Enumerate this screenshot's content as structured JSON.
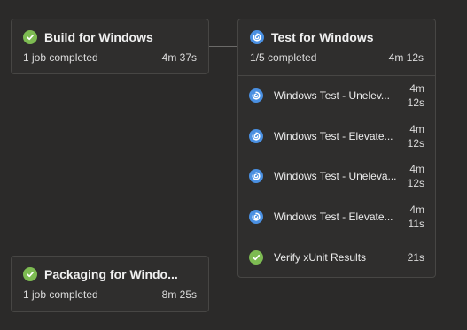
{
  "stages": {
    "build": {
      "title": "Build for Windows",
      "status": "success",
      "summary": "1 job completed",
      "duration": "4m 37s"
    },
    "test": {
      "title": "Test for Windows",
      "status": "running",
      "summary": "1/5 completed",
      "duration": "4m 12s",
      "jobs": [
        {
          "name": "Windows Test - Unelev...",
          "duration": "4m 12s",
          "status": "running"
        },
        {
          "name": "Windows Test - Elevate...",
          "duration": "4m 12s",
          "status": "running"
        },
        {
          "name": "Windows Test - Uneleva...",
          "duration": "4m 12s",
          "status": "running"
        },
        {
          "name": "Windows Test - Elevate...",
          "duration": "4m 11s",
          "status": "running"
        },
        {
          "name": "Verify xUnit Results",
          "duration": "21s",
          "status": "success"
        }
      ]
    },
    "packaging": {
      "title": "Packaging for Windo...",
      "status": "success",
      "summary": "1 job completed",
      "duration": "8m 25s"
    }
  },
  "colors": {
    "success": "#7dbb52",
    "running": "#4a90e2",
    "background": "#2b2a29"
  },
  "icons": {
    "success": "check-circle-icon",
    "running": "in-progress-icon"
  }
}
